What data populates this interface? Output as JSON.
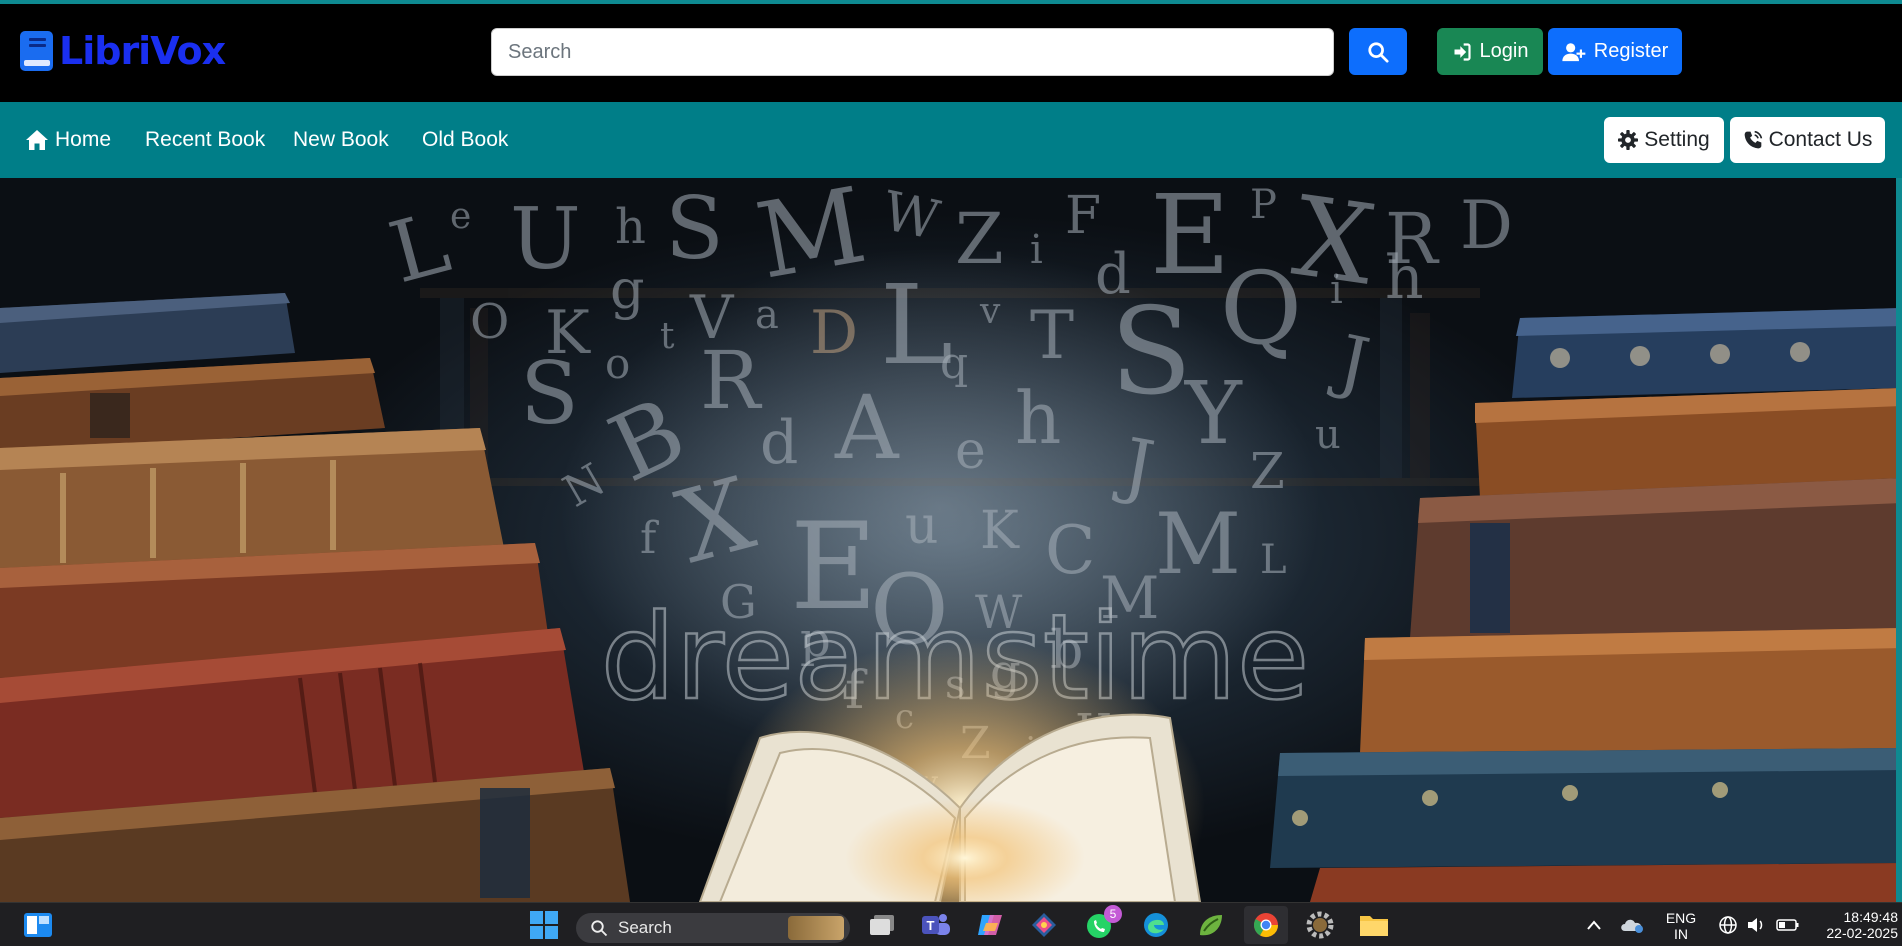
{
  "header": {
    "brand": "LibriVox",
    "search_placeholder": "Search",
    "login_label": "Login",
    "register_label": "Register"
  },
  "nav": {
    "items": [
      {
        "label": "Home",
        "icon": "home-icon"
      },
      {
        "label": "Recent Book"
      },
      {
        "label": "New Book"
      },
      {
        "label": "Old Book"
      }
    ],
    "setting_label": "Setting",
    "contact_label": "Contact Us"
  },
  "hero": {
    "watermark": "dreamstime",
    "letters": "L e U h S M W Z i F d E X P R D O K g V a D L V T S Q h i S o t R q A h Y J B d u e J u N f X E u K C M G O W M p b y f c s g Z j K",
    "colors": {
      "accent": "#007e88",
      "primary": "#0d6efd",
      "success": "#198754"
    }
  },
  "taskbar": {
    "search_label": "Search",
    "whatsapp_badge": "5",
    "lang_primary": "ENG",
    "lang_secondary": "IN",
    "time": "18:49:48",
    "date": "22-02-2025"
  }
}
